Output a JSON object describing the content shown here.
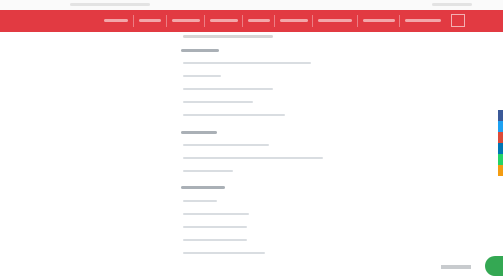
{
  "nav": {
    "items": [
      "",
      "",
      "",
      "",
      "",
      "",
      "",
      "",
      "",
      ""
    ]
  },
  "content": {
    "breadcrumb": "",
    "sections": [
      {
        "heading": "",
        "items": [
          "",
          "",
          "",
          "",
          "",
          ""
        ]
      },
      {
        "heading": "",
        "items": [
          "",
          "",
          ""
        ]
      },
      {
        "heading": "",
        "items": [
          "",
          "",
          "",
          "",
          ""
        ]
      }
    ]
  },
  "social": [
    "facebook",
    "twitter",
    "google-plus",
    "linkedin",
    "whatsapp",
    "email"
  ],
  "colors": {
    "navbar": "#e23a42",
    "chat_button": "#34a853",
    "social": [
      "#3b5998",
      "#1da1f2",
      "#dd4b39",
      "#0077b5",
      "#25d366",
      "#f39c12"
    ]
  },
  "chat": {
    "label": ""
  }
}
